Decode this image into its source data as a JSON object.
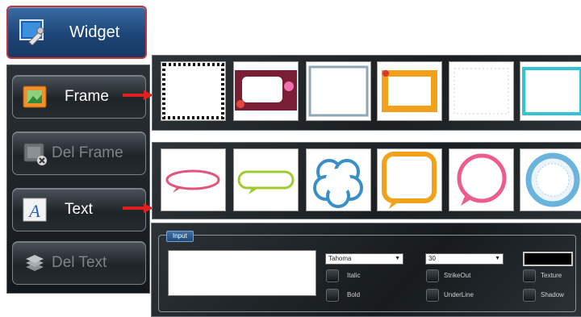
{
  "toolbar": {
    "widget_label": "Widget",
    "frame_label": "Frame",
    "del_frame_label": "Del Frame",
    "text_label": "Text",
    "del_text_label": "Del Text"
  },
  "input_panel": {
    "tab_label": "Input",
    "text_value": "",
    "font_value": "Tahoma",
    "size_value": "30",
    "color_value": "#000000",
    "checkboxes": {
      "italic": "Italic",
      "bold": "Bold",
      "strikeout": "StrikeOut",
      "underline": "UnderLine",
      "texture": "Texture",
      "shadow": "Shadow"
    }
  },
  "icons": {
    "widget": "widget-tool-icon",
    "frame": "picture-frame-icon",
    "del_frame": "delete-frame-icon",
    "text": "text-letter-a-icon",
    "del_text": "delete-text-icon"
  },
  "colors": {
    "arrow": "#e02020",
    "widget_active": "#1d4576"
  }
}
